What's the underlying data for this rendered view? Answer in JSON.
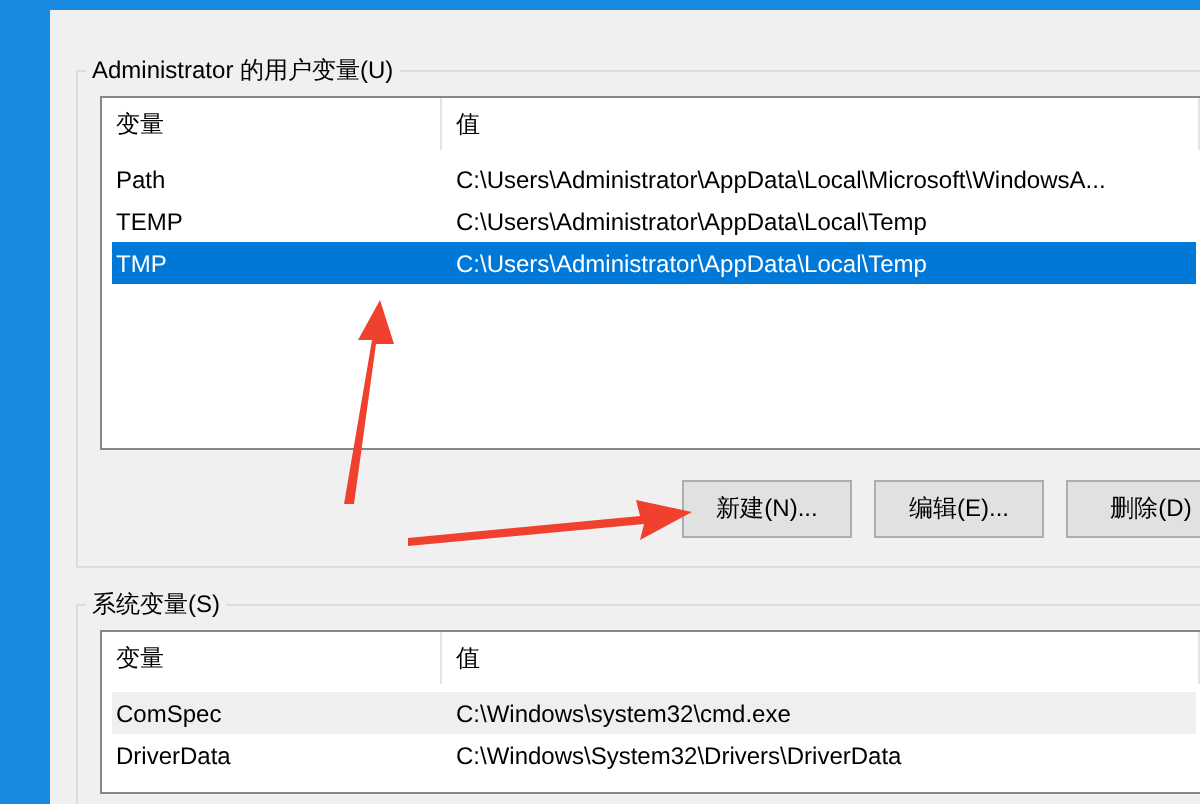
{
  "user_vars": {
    "title": "Administrator 的用户变量(U)",
    "columns": [
      "变量",
      "值"
    ],
    "rows": [
      {
        "name": "Path",
        "value": "C:\\Users\\Administrator\\AppData\\Local\\Microsoft\\WindowsA...",
        "selected": false
      },
      {
        "name": "TEMP",
        "value": "C:\\Users\\Administrator\\AppData\\Local\\Temp",
        "selected": false
      },
      {
        "name": "TMP",
        "value": "C:\\Users\\Administrator\\AppData\\Local\\Temp",
        "selected": true
      }
    ],
    "buttons": [
      "新建(N)...",
      "编辑(E)...",
      "删除(D)"
    ]
  },
  "system_vars": {
    "title": "系统变量(S)",
    "columns": [
      "变量",
      "值"
    ],
    "rows": [
      {
        "name": "ComSpec",
        "value": "C:\\Windows\\system32\\cmd.exe",
        "selected": false,
        "hovered": true
      },
      {
        "name": "DriverData",
        "value": "C:\\Windows\\System32\\Drivers\\DriverData",
        "selected": false
      }
    ]
  }
}
